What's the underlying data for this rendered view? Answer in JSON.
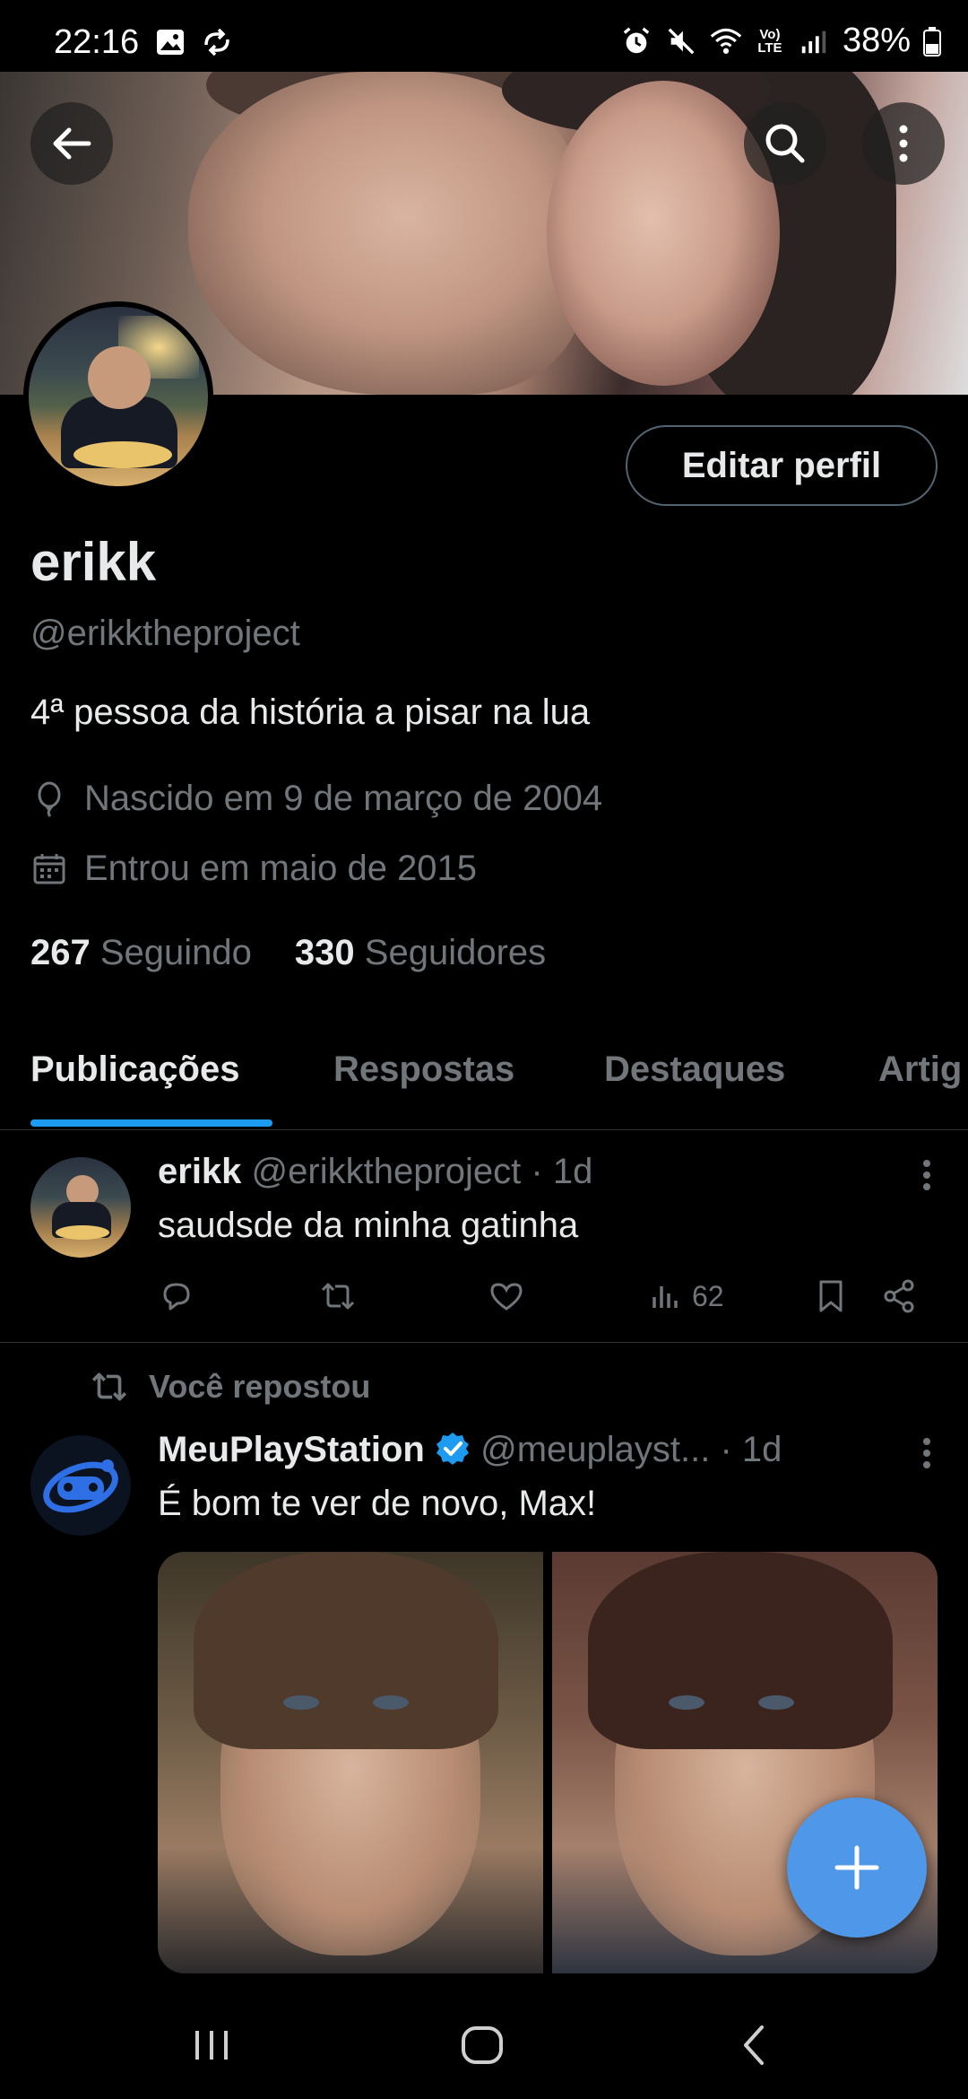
{
  "status_bar": {
    "time": "22:16",
    "battery": "38%",
    "network_label": "Vo) LTE"
  },
  "header": {
    "back_icon": "arrow-left-icon",
    "search_icon": "search-icon",
    "more_icon": "more-vertical-icon"
  },
  "profile": {
    "edit_button_label": "Editar perfil",
    "name": "erikk",
    "handle": "@erikktheproject",
    "bio": "4ª pessoa da história a pisar na lua",
    "birth": "Nascido em 9 de março de 2004",
    "joined": "Entrou em maio de 2015",
    "following_count": "267",
    "following_label": "Seguindo",
    "followers_count": "330",
    "followers_label": "Seguidores"
  },
  "tabs": [
    {
      "label": "Publicações",
      "active": true
    },
    {
      "label": "Respostas",
      "active": false
    },
    {
      "label": "Destaques",
      "active": false
    },
    {
      "label": "Artig",
      "active": false
    }
  ],
  "posts": [
    {
      "author": "erikk",
      "handle": "@erikktheproject",
      "time": "· 1d",
      "text": "saudsde da minha gatinha",
      "views": "62"
    },
    {
      "repost_label": "Você repostou",
      "author": "MeuPlayStation",
      "handle": "@meuplayst...",
      "time": "· 1d",
      "text": "É bom te ver de novo, Max!",
      "verified": true
    }
  ],
  "colors": {
    "accent": "#1d9bf0",
    "fab": "#4f97e8",
    "muted": "#71767b",
    "text": "#e7e9ea",
    "divider": "#2f3336"
  }
}
